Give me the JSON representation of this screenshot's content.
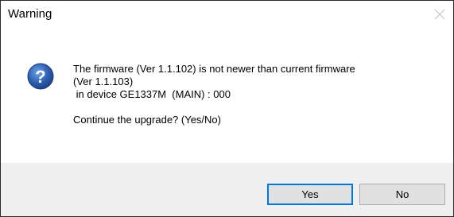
{
  "window": {
    "title": "Warning",
    "close_icon": "close-icon"
  },
  "message": {
    "icon": "question-icon",
    "line1": "The firmware (Ver 1.1.102) is not newer than current firmware",
    "line2": "(Ver 1.1.103)",
    "line3": " in device GE1337M  (MAIN) : 000",
    "line4": "Continue the upgrade? (Yes/No)"
  },
  "buttons": {
    "yes_label": "Yes",
    "no_label": "No"
  },
  "colors": {
    "focus_border": "#0078d7",
    "footer_bg": "#f0f0f0",
    "icon_blue": "#2a5db0"
  }
}
